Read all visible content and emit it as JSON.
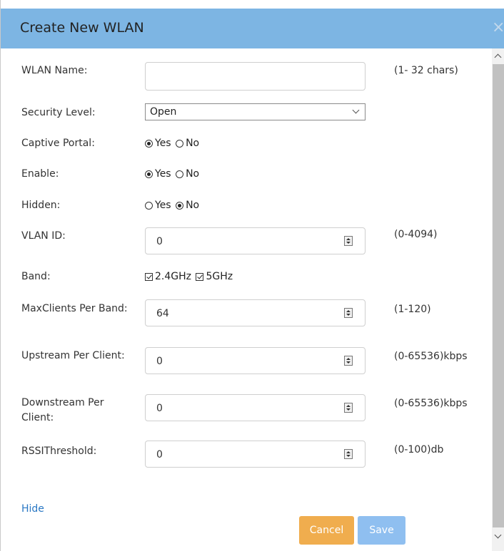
{
  "dialog": {
    "title": "Create New WLAN",
    "close": "×"
  },
  "fields": {
    "wlan_name": {
      "label": "WLAN Name:",
      "value": "",
      "hint": "(1- 32 chars)"
    },
    "security_level": {
      "label": "Security Level:",
      "selected": "Open"
    },
    "captive_portal": {
      "label": "Captive Portal:",
      "yes": "Yes",
      "no": "No",
      "selected": "Yes"
    },
    "enable": {
      "label": "Enable:",
      "yes": "Yes",
      "no": "No",
      "selected": "Yes"
    },
    "hidden": {
      "label": "Hidden:",
      "yes": "Yes",
      "no": "No",
      "selected": "No"
    },
    "vlan_id": {
      "label": "VLAN ID:",
      "value": "0",
      "hint": "(0-4094)"
    },
    "band": {
      "label": "Band:",
      "opt1": "2.4GHz",
      "opt1_checked": true,
      "opt2": "5GHz",
      "opt2_checked": true
    },
    "max_clients": {
      "label": "MaxClients Per Band:",
      "value": "64",
      "hint": "(1-120)"
    },
    "upstream": {
      "label": "Upstream Per Client:",
      "value": "0",
      "hint": "(0-65536)kbps"
    },
    "downstream": {
      "label": "Downstream Per Client:",
      "value": "0",
      "hint": "(0-65536)kbps"
    },
    "rssi": {
      "label": "RSSIThreshold:",
      "value": "0",
      "hint": "(0-100)db"
    }
  },
  "footer": {
    "hide": "Hide",
    "cancel": "Cancel",
    "save": "Save"
  },
  "colors": {
    "header": "#7db5e3",
    "cancel": "#f0ad4e",
    "save": "#8fbff0",
    "link": "#2a78c4"
  }
}
